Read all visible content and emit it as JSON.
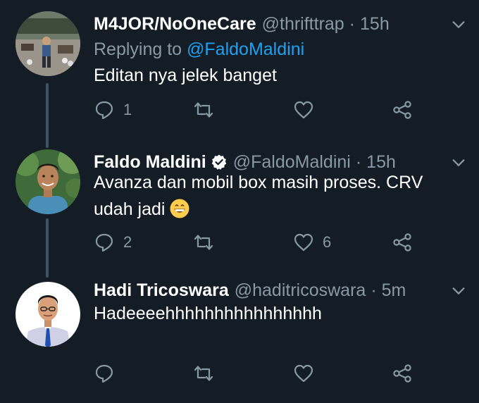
{
  "tweets": [
    {
      "name": "M4JOR/NoOneCare",
      "handle": "@thrifttrap",
      "separator": "·",
      "time": "15h",
      "reply_prefix": "Replying to",
      "reply_mention": "@FaldoMaldini",
      "text": "Editan nya jelek banget",
      "reply_count": "1",
      "retweet_count": "",
      "like_count": "",
      "avatar": "avatar-photo-man-standing"
    },
    {
      "name": "Faldo Maldini",
      "handle": "@FaldoMaldini",
      "separator": "·",
      "time": "15h",
      "verified": true,
      "text_line1": "Avanza dan mobil box masih proses. CRV",
      "text_line2": "udah jadi",
      "emoji": "grinning-face-emoji",
      "reply_count": "2",
      "retweet_count": "",
      "like_count": "6",
      "avatar": "avatar-photo-man-smiling"
    },
    {
      "name": "Hadi Tricoswara",
      "handle": "@haditricoswara",
      "separator": "·",
      "time": "5m",
      "text": "Hadeeeehhhhhhhhhhhhhhhh",
      "reply_count": "",
      "retweet_count": "",
      "like_count": "",
      "avatar": "avatar-illustration-man-tie"
    }
  ],
  "colors": {
    "background": "#141d26",
    "text": "#ffffff",
    "muted": "#8899a6",
    "link": "#1da1f2",
    "thread_line": "#3d5466",
    "verified": "#ffffff"
  }
}
